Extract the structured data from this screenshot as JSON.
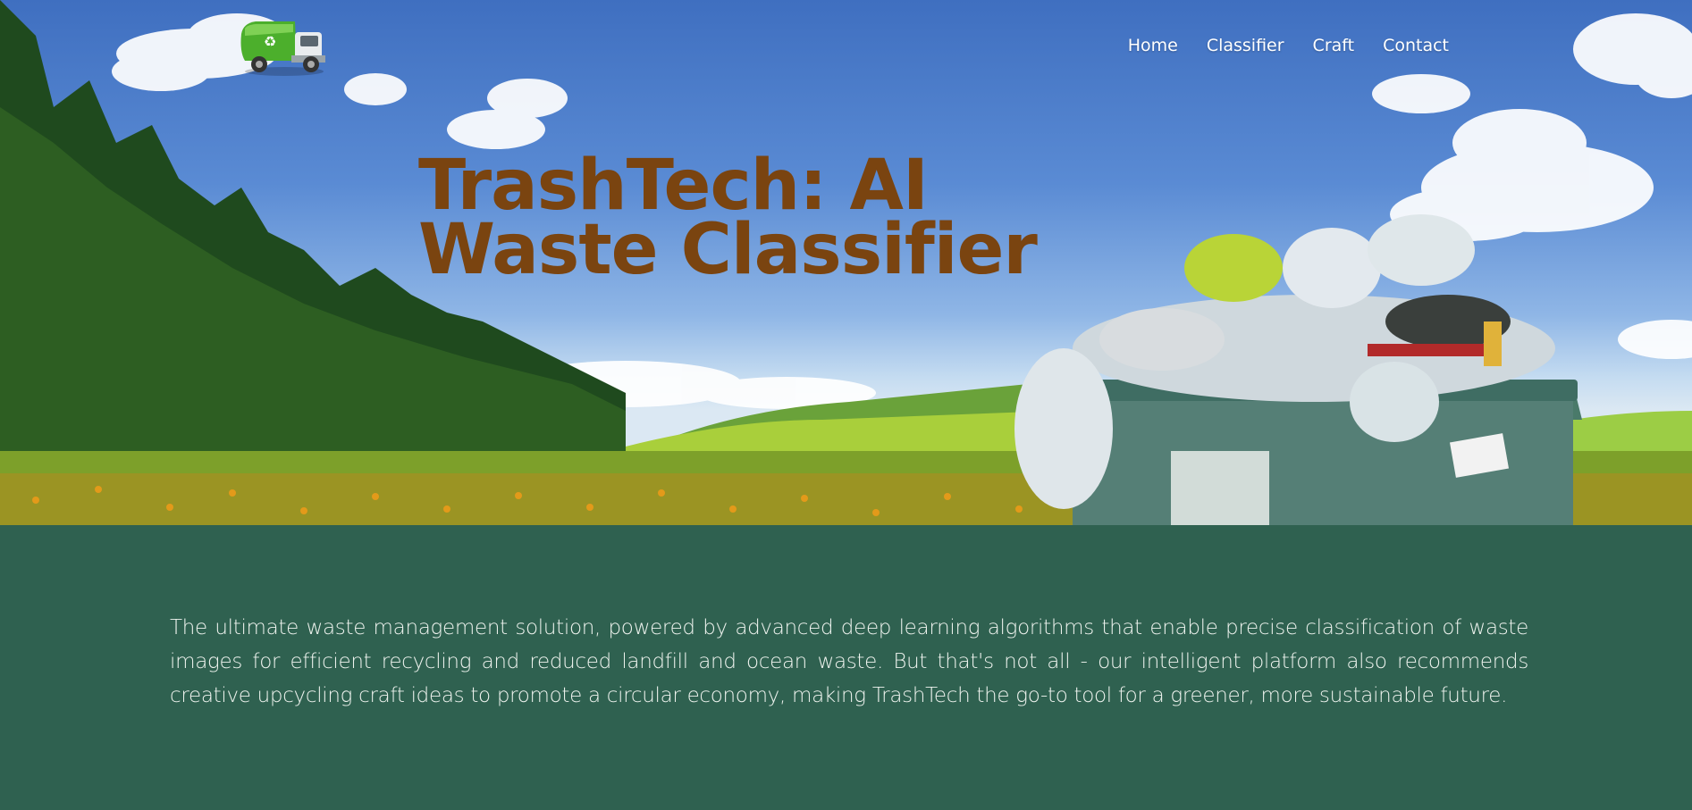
{
  "header": {
    "logo_icon": "garbage-truck-icon",
    "nav": [
      {
        "label": "Home"
      },
      {
        "label": "Classifier"
      },
      {
        "label": "Craft"
      },
      {
        "label": "Contact"
      }
    ]
  },
  "hero": {
    "title": "TrashTech: AI Waste Classifier",
    "background": "landscape-with-overflowing-dumpster"
  },
  "main": {
    "intro": "The ultimate waste management solution, powered by advanced deep learning algorithms that enable precise classification of waste images for efficient recycling and reduced landfill and ocean waste. But that's not all - our intelligent platform also recommends creative upcycling craft ideas to promote a circular economy, making TrashTech the go-to tool for a greener, more sustainable future."
  },
  "colors": {
    "title": "#7a4410",
    "section_bg": "#2f6150",
    "nav_text": "#ffffff"
  }
}
